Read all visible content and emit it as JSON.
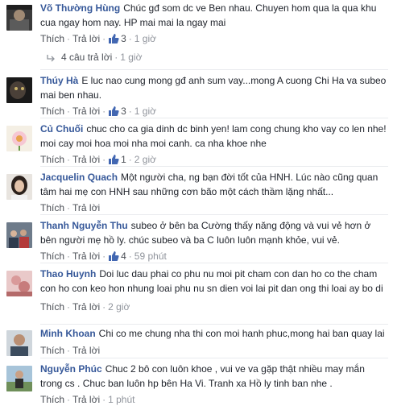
{
  "ui": {
    "like_label": "Thích",
    "reply_label": "Trả lời",
    "dot": "·"
  },
  "comments": [
    {
      "author": "Võ Thường Hùng",
      "text": "Chúc gđ som dc ve Ben nhau. Chuyen hom qua la qua khu cua ngay hom nay. HP mai mai la ngay mai",
      "likes": "3",
      "time": "1 giờ",
      "avatar": "avatar-dark-portrait"
    },
    {
      "author": "Thúy Hà",
      "text": "E luc nao cung mong gđ anh sum vay...mong A cuong Chi Ha va subeo mai ben nhau.",
      "likes": "3",
      "time": "1 giờ",
      "avatar": "avatar-dark-close-up"
    },
    {
      "author": "Củ Chuối",
      "text": "chuc cho ca gia dinh dc binh yen! lam cong chung kho vay co len nhe! moi cay moi hoa moi nha moi canh. ca nha khoe nhe",
      "likes": "1",
      "time": "2 giờ",
      "avatar": "avatar-cartoon-flower"
    },
    {
      "author": "Jacquelin Quach",
      "text": "Một người cha, ng bạn đời tốt của HNH. Lúc nào cũng quan tâm hai mẹ con HNH sau những cơn bão một cách thầm lặng nhất...",
      "likes": "",
      "time": "",
      "avatar": "avatar-woman-portrait"
    },
    {
      "author": "Thanh Nguyễn Thu",
      "text": "subeo ở bên ba Cường thấy năng động và vui vẻ hơn ở bên người mẹ hồ ly. chúc subeo và ba C luôn luôn mạnh khỏe, vui vẻ.",
      "likes": "4",
      "time": "59 phút",
      "avatar": "avatar-group-photo"
    },
    {
      "author": "Thao Huynh",
      "text": "Doi luc dau phai co phu nu moi pit cham con dan ho co the cham con ho con keo hon nhung loai phu nu sn dien voi lai pit dan ong thi loai ay bo di",
      "likes": "",
      "time": "2 giờ",
      "avatar": "avatar-pink-photo"
    },
    {
      "author": "Minh Khoan",
      "text": "Chi co me chung nha thi con moi hanh phuc,mong hai ban quay lai",
      "likes": "",
      "time": "",
      "avatar": "avatar-man-portrait"
    },
    {
      "author": "Nguyễn Phúc",
      "text": "Chuc 2 bô con luôn khoe , vui ve va gặp thật nhiều may mắn trong cs . Chuc ban luôn hp bên Ha Vi. Tranh xa Hồ ly tinh ban nhe .",
      "likes": "",
      "time": "1 phút",
      "avatar": "avatar-man-outdoor"
    }
  ],
  "replies_link": {
    "label": "4 câu trả lời",
    "time": "1 giờ"
  },
  "colors": {
    "author": "#365899",
    "meta": "#90949c",
    "like_blue": "#4267b2"
  }
}
